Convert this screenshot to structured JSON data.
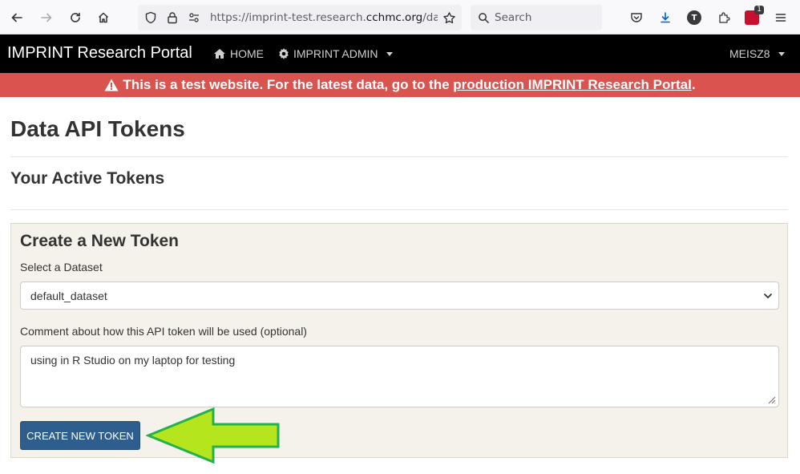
{
  "browser": {
    "url_prefix": "https://imprint-test.research.",
    "url_host": "cchmc.org",
    "url_suffix": "/data_a",
    "search_placeholder": "Search",
    "profile_initial": "T",
    "extension_badge": "1"
  },
  "navbar": {
    "brand": "IMPRINT Research Portal",
    "home": "HOME",
    "admin": "IMPRINT ADMIN",
    "user": "MEISZ8"
  },
  "alert": {
    "text": "This is a test website. For the latest data, go to the ",
    "link": "production IMPRINT Research Portal",
    "end": "."
  },
  "page": {
    "title": "Data API Tokens",
    "section": "Your Active Tokens"
  },
  "form": {
    "title": "Create a New Token",
    "dataset_label": "Select a Dataset",
    "dataset_value": "default_dataset",
    "comment_label": "Comment about how this API token will be used (optional)",
    "comment_value": "using in R Studio on my laptop for testing",
    "submit": "CREATE NEW TOKEN"
  },
  "colors": {
    "navbar": "#000000",
    "alert": "#d9534f",
    "button": "#2e5e8e",
    "panel": "#f5f2ec",
    "arrow": "#b5e61d"
  }
}
